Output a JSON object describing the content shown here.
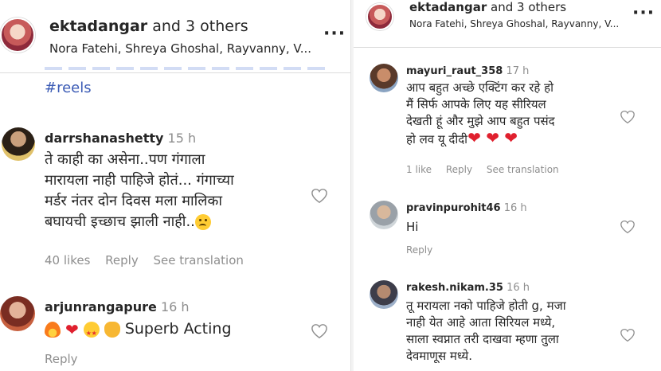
{
  "left": {
    "header": {
      "title_user": "ektadangar",
      "title_rest": " and 3 others",
      "subtitle": "Nora Fatehi, Shreya Ghoshal, Rayvanny, V..."
    },
    "caption_tag": "#reels",
    "comments": [
      {
        "user": "darrshanashetty",
        "time": "15 h",
        "lines": [
          "ते काही का असेना..पण गंगाला",
          "मारायला नाही पाहिजे होतं... गंगाच्या",
          "मर्डर नंतर दोन दिवस मला मालिका",
          "बघायची इच्छाच झाली नाही.."
        ],
        "likes": "40 likes",
        "reply": "Reply",
        "translate": "See translation"
      },
      {
        "user": "arjunrangapure",
        "time": "16 h",
        "text": "Superb Acting",
        "reply": "Reply"
      }
    ]
  },
  "right": {
    "header": {
      "title_user": "ektadangar",
      "title_rest": " and 3 others",
      "subtitle": "Nora Fatehi, Shreya Ghoshal, Rayvanny, V..."
    },
    "comments": [
      {
        "user": "mayuri_raut_358",
        "time": "17 h",
        "lines": [
          "आप बहुत अच्छे एक्टिंग कर रहे हो",
          "मैं सिर्फ आपके लिए यह सीरियल",
          "देखती हूं और मुझे आप बहुत पसंद",
          "हो लव यू दीदी"
        ],
        "likes": "1 like",
        "reply": "Reply",
        "translate": "See translation"
      },
      {
        "user": "pravinpurohit46",
        "time": "16 h",
        "text": "Hi",
        "reply": "Reply"
      },
      {
        "user": "rakesh.nikam.35",
        "time": "16 h",
        "lines": [
          "तू मरायला नको पाहिजे होती g, मजा",
          "नाही येत आहे आता सिरियल मध्ये,",
          "साला स्वप्नात तरी दाखवा म्हणा तुला",
          "देवमाणूस मध्ये."
        ]
      }
    ]
  },
  "colors": {
    "link": "#3b5bb5",
    "muted": "#8e8e8e",
    "heart": "#e0202e"
  },
  "icons": [
    "more-icon",
    "heart-outline-icon",
    "emoji"
  ]
}
